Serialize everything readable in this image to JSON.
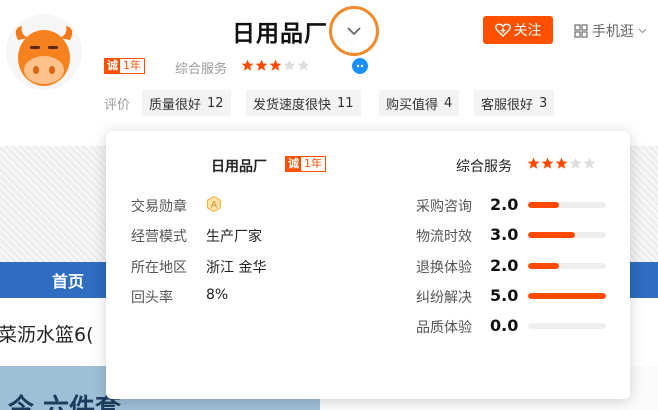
{
  "header": {
    "shop_name": "日用品厂",
    "badge": {
      "cheng": "诚",
      "years": "1年"
    },
    "service_label": "综合服务",
    "service_rating": 3,
    "follow_label": "关注",
    "mobile_label": "手机逛"
  },
  "reviews": {
    "label": "评价",
    "tags": [
      {
        "label": "质量很好",
        "count": "12"
      },
      {
        "label": "发货速度很快",
        "count": "11"
      },
      {
        "label": "购买值得",
        "count": "4"
      },
      {
        "label": "客服很好",
        "count": "3"
      }
    ]
  },
  "background": {
    "nav_home": "首页",
    "product_text": "菜沥水篮6(",
    "banner_text": "今 六件套"
  },
  "popup": {
    "shop_name": "日用品厂",
    "badge": {
      "cheng": "诚",
      "years": "1年"
    },
    "service_label": "综合服务",
    "service_rating": 3,
    "info": [
      {
        "key": "交易勋章",
        "value": ""
      },
      {
        "key": "经营模式",
        "value": "生产厂家"
      },
      {
        "key": "所在地区",
        "value": "浙江 金华"
      },
      {
        "key": "回头率",
        "value": "8%"
      }
    ],
    "metrics": [
      {
        "label": "采购咨询",
        "value": "2.0",
        "fraction": 0.4
      },
      {
        "label": "物流时效",
        "value": "3.0",
        "fraction": 0.6
      },
      {
        "label": "退换体验",
        "value": "2.0",
        "fraction": 0.4
      },
      {
        "label": "纠纷解决",
        "value": "5.0",
        "fraction": 1.0
      },
      {
        "label": "品质体验",
        "value": "0.0",
        "fraction": 0.0
      }
    ]
  },
  "colors": {
    "accent": "#ff5000",
    "star_on": "#ff4a00",
    "star_off": "#dddddd",
    "nav": "#2e6dbf",
    "highlight_ring": "#f08a2c"
  }
}
